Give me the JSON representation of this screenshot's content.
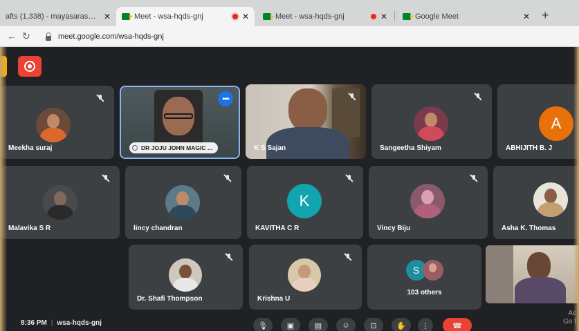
{
  "browser": {
    "tabs": [
      {
        "title": "afts (1,338) - mayasaraswathy@",
        "active": false,
        "recording": false
      },
      {
        "title": "Meet - wsa-hqds-gnj",
        "active": true,
        "recording": true
      },
      {
        "title": "Meet - wsa-hqds-gnj",
        "active": false,
        "recording": true
      },
      {
        "title": "Google Meet",
        "active": false,
        "recording": false
      }
    ],
    "close_glyph": "✕",
    "new_tab_glyph": "+",
    "url": "meet.google.com/wsa-hqds-gnj"
  },
  "meeting": {
    "recording_color": "#ea4335",
    "participants": [
      {
        "name": "Meekha suraj",
        "muted": true,
        "type": "photo"
      },
      {
        "name": "DR JOJU JOHN MAGIC ...",
        "muted": false,
        "type": "video",
        "pinned": true
      },
      {
        "name": "K S Sajan",
        "muted": true,
        "type": "video"
      },
      {
        "name": "Sangeetha Shiyam",
        "muted": true,
        "type": "photo"
      },
      {
        "name": "ABHIJITH B. J",
        "muted": false,
        "type": "letter",
        "letter": "A",
        "color": "#e8710a"
      },
      {
        "name": "Malavika S R",
        "muted": true,
        "type": "photo"
      },
      {
        "name": "lincy chandran",
        "muted": true,
        "type": "photo"
      },
      {
        "name": "KAVITHA C R",
        "muted": true,
        "type": "letter",
        "letter": "K",
        "color": "#12a4af"
      },
      {
        "name": "Vincy Biju",
        "muted": true,
        "type": "photo"
      },
      {
        "name": "Asha K. Thomas",
        "muted": false,
        "type": "photo"
      },
      {
        "name": "Dr. Shafi Thompson",
        "muted": true,
        "type": "photo"
      },
      {
        "name": "Krishna U",
        "muted": true,
        "type": "photo"
      },
      {
        "name": "",
        "muted": false,
        "type": "video"
      }
    ],
    "others": {
      "letter": "S",
      "label": "103 others"
    },
    "more_options_glyph": "•••"
  },
  "bottom_bar": {
    "time": "8:36 PM",
    "code": "wsa-hqds-gnj",
    "controls": [
      "mic",
      "camera",
      "captions",
      "emoji",
      "present",
      "raise-hand",
      "more",
      "end-call"
    ],
    "activate_text": [
      "Ac",
      "Go t"
    ]
  }
}
